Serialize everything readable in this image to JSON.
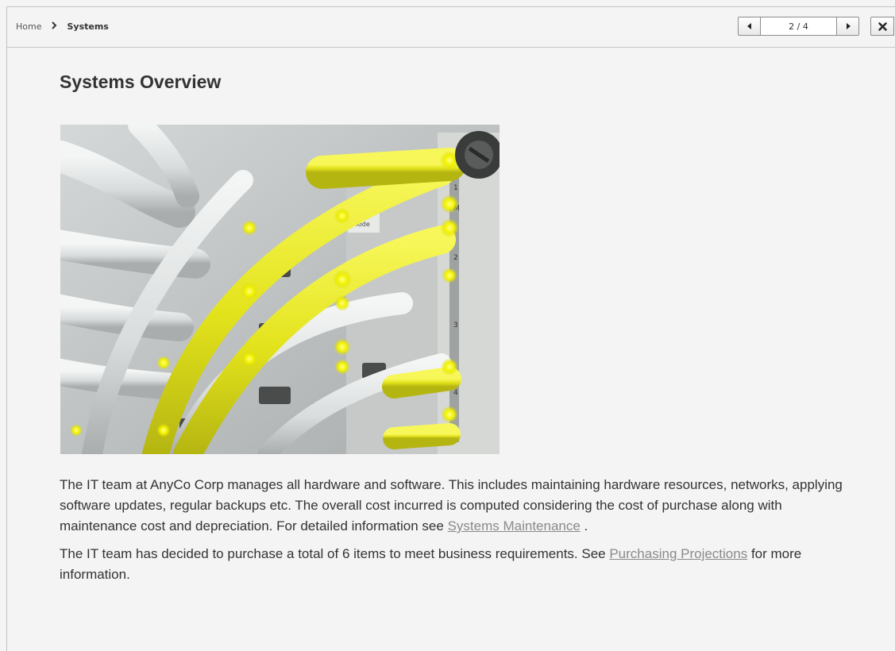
{
  "breadcrumb": {
    "home": "Home",
    "current": "Systems"
  },
  "pager": {
    "count": "2 / 4",
    "prev_icon": "triangle-left-icon",
    "next_icon": "triangle-right-icon"
  },
  "close_icon": "close-icon",
  "title": "Systems Overview",
  "hero_image": {
    "subject": "network cables plugged into server switch",
    "colors": {
      "cable_yellow": "#e6e617",
      "cable_white": "#e2e4e4",
      "panel": "#b8bcbc"
    }
  },
  "paragraph1": {
    "text": "The IT team at AnyCo Corp manages all hardware and software. This includes maintaining hardware resources, networks, applying software updates, regular backups etc. The overall cost incurred is computed considering the cost of purchase along with maintenance cost and depreciation. For detailed information see ",
    "link": "Systems Maintenance",
    "suffix": " ."
  },
  "paragraph2": {
    "text": "The IT team has decided to purchase a total of 6 items to meet business requirements. See ",
    "link": "Purchasing Projections",
    "suffix": " for more information."
  },
  "colors": {
    "background": "#f4f4f4",
    "border": "#c4c4c4",
    "text": "#333333",
    "link": "#8a8a8a"
  }
}
